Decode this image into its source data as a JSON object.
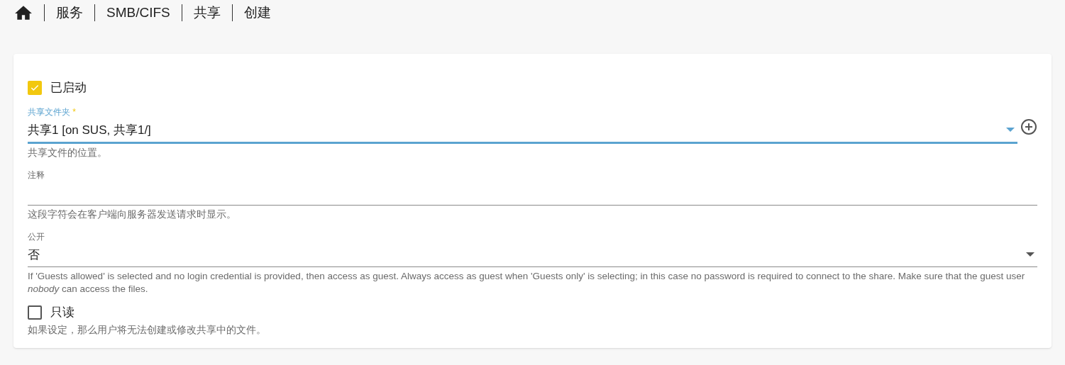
{
  "breadcrumb": [
    "服务",
    "SMB/CIFS",
    "共享",
    "创建"
  ],
  "form": [
    {
      "kind": "checkbox",
      "label": "已启动",
      "checked": true
    },
    {
      "kind": "select",
      "label": "共享文件夹",
      "required": true,
      "required_mark": "*",
      "focused": true,
      "value": "共享1 [on SUS, 共享1/]",
      "add_button": true,
      "hint": "共享文件的位置。"
    },
    {
      "kind": "text",
      "label": "注释",
      "hint": "这段字符会在客户端向服务器发送请求时显示。"
    },
    {
      "kind": "select",
      "label": "公开",
      "required": false,
      "focused": false,
      "value": "否",
      "add_button": false,
      "hint": "If 'Guests allowed' is selected and no login credential is provided, then access as guest. Always access as guest when 'Guests only' is selecting; in this case no password is required to connect to the share. Make sure that the guest user *nobody* can access the files."
    },
    {
      "kind": "checkbox",
      "label": "只读",
      "checked": false,
      "hint": "如果设定，那么用户将无法创建或修改共享中的文件。"
    }
  ]
}
